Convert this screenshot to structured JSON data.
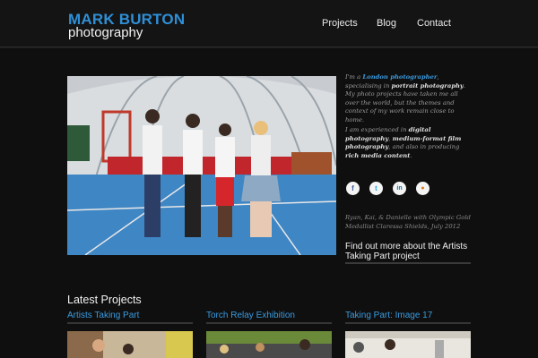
{
  "header": {
    "logo_top": "MARK BURTON",
    "logo_bottom": "photography",
    "nav": [
      {
        "label": "Projects"
      },
      {
        "label": "Blog"
      },
      {
        "label": "Contact"
      }
    ]
  },
  "intro": {
    "p1_a": "I'm a ",
    "p1_link": "London photographer",
    "p1_b": ", specialising in ",
    "p1_bold": "portrait photography",
    "p1_c": ". My photo projects have taken me all over the world, but the themes and context of my work remain close to home.",
    "p2_a": "I am experienced in ",
    "p2_bold1": "digital photography",
    "p2_b": ", ",
    "p2_bold2": "medium-format film photography",
    "p2_c": ", and also in producing ",
    "p2_bold3": "rich media content",
    "p2_d": "."
  },
  "social": [
    {
      "icon": "facebook-icon",
      "glyph": "f",
      "color": "#3b5998"
    },
    {
      "icon": "twitter-icon",
      "glyph": "t",
      "color": "#2fa6de"
    },
    {
      "icon": "linkedin-icon",
      "glyph": "in",
      "color": "#0e76a8"
    },
    {
      "icon": "rss-icon",
      "glyph": "●",
      "color": "#e07a1f"
    }
  ],
  "hero_caption": "Ryan, Kai, & Danielle with Olympic Gold Medallist Claressa Shields, July 2012",
  "find_out": "Find out more about the Artists Taking Part project",
  "latest": {
    "heading": "Latest Projects",
    "projects": [
      {
        "title": "Artists Taking Part"
      },
      {
        "title": "Torch Relay Exhibition"
      },
      {
        "title": "Taking Part: Image 17"
      }
    ]
  }
}
